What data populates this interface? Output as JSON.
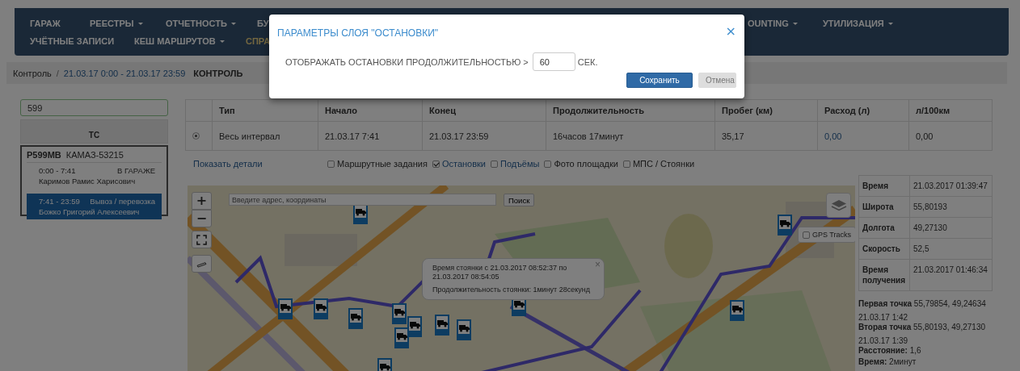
{
  "nav": {
    "top_row": [
      {
        "label": "ГАРАЖ",
        "dropdown": false,
        "active": false
      },
      {
        "label": "РЕЕСТРЫ",
        "dropdown": true,
        "active": false
      },
      {
        "label": "ОТЧЕТНОСТЬ",
        "dropdown": true,
        "active": false
      },
      {
        "label": "БУ",
        "dropdown": false,
        "active": false
      },
      {
        "label": "OUNTING",
        "dropdown": true,
        "active": false
      },
      {
        "label": "УТИЛИЗАЦИЯ",
        "dropdown": true,
        "active": false
      }
    ],
    "bottom_row": [
      {
        "label": "УЧЁТНЫЕ ЗАПИСИ",
        "dropdown": false,
        "active": false
      },
      {
        "label": "КЕШ МАРШРУТОВ",
        "dropdown": true,
        "active": false
      },
      {
        "label": "СПРА",
        "dropdown": false,
        "active": true
      }
    ]
  },
  "breadcrumb": {
    "separator": "/",
    "items": [
      {
        "label": "Контроль",
        "kind": "plain"
      },
      {
        "label": "21.03.17 0:00 - 21.03.17 23:59",
        "kind": "link"
      },
      {
        "label": "КОНТРОЛЬ",
        "kind": "current"
      }
    ]
  },
  "vehicle_search": {
    "value": "599"
  },
  "vehicle_list": {
    "header": "ТС",
    "vehicles": [
      {
        "plate": "Р599МВ",
        "model": "КАМАЗ-53215",
        "trips": [
          {
            "time": "0:00 - 7:41",
            "status": "В ГАРАЖЕ",
            "driver": "Каримов Рамис Харисович",
            "selected": false
          },
          {
            "time": "7:41 - 23:59",
            "status": "Вывоз / перевозка",
            "driver": "Божко Григорий Алексеевич",
            "selected": true
          }
        ]
      }
    ]
  },
  "intervals": {
    "columns": [
      "Тип",
      "Начало",
      "Конец",
      "Продолжительность",
      "Пробег (км)",
      "Расход (л)",
      "л/100км"
    ],
    "rows": [
      {
        "selected": true,
        "cells": [
          {
            "text": "Весь интервал",
            "link": false
          },
          {
            "text": "21.03.17 7:41",
            "link": false
          },
          {
            "text": "21.03.17 23:59",
            "link": false
          },
          {
            "text": "16часов 17минут",
            "link": false
          },
          {
            "text": "35,17",
            "link": false
          },
          {
            "text": "0,00",
            "link": true
          },
          {
            "text": "0,00",
            "link": false
          }
        ]
      }
    ]
  },
  "details_link": "Показать детали",
  "layers": [
    {
      "label": "Маршрутные задания",
      "checked": false,
      "link": false
    },
    {
      "label": "Остановки",
      "checked": true,
      "link": true
    },
    {
      "label": "Подъёмы",
      "checked": false,
      "link": true
    },
    {
      "label": "Фото площадки",
      "checked": false,
      "link": false
    },
    {
      "label": "МПС / Стоянки",
      "checked": false,
      "link": false
    }
  ],
  "map": {
    "zoom_in": "+",
    "zoom_out": "−",
    "search": {
      "placeholder": "Введите адрес, координаты"
    },
    "search_button": "Поиск",
    "gps_tracks": {
      "label": "GPS Tracks",
      "checked": false
    },
    "popup": {
      "close": "×",
      "lines": [
        "Время стоянки с 21.03.2017 08:52:37 по 21.03.2017 08:54:05",
        "Продолжительность стоянки: 1минут 28секунд"
      ]
    }
  },
  "point_info": {
    "rows": [
      {
        "label": "Время",
        "value": "21.03.2017 01:39:47"
      },
      {
        "label": "Широта",
        "value": "55,80193"
      },
      {
        "label": "Долгота",
        "value": "49,27130"
      },
      {
        "label": "Скорость",
        "value": "52,5"
      },
      {
        "label": "Время получения",
        "value": "21.03.2017 01:46:34"
      }
    ]
  },
  "summary": [
    {
      "label": "Первая точка",
      "value": "55,79854, 49,24634"
    },
    {
      "value": "21.03.17 1:42"
    },
    {
      "label": "Вторая точка",
      "value": "55,80193, 49,27130"
    },
    {
      "value": "21.03.17 1:39"
    },
    {
      "label": "Расстояние:",
      "value": "1,6"
    },
    {
      "label": "Время:",
      "value": "2минут"
    }
  ],
  "modal": {
    "title": "ПАРАМЕТРЫ СЛОЯ \"ОСТАНОВКИ\"",
    "close": "×",
    "label": "ОТОБРАЖАТЬ ОСТАНОВКИ ПРОДОЛЖИТЕЛЬНОСТЬЮ >",
    "value": "60",
    "unit": "СЕК.",
    "buttons": [
      {
        "label": "Сохранить",
        "kind": "primary"
      },
      {
        "label": "Отмена",
        "kind": "default"
      }
    ]
  }
}
